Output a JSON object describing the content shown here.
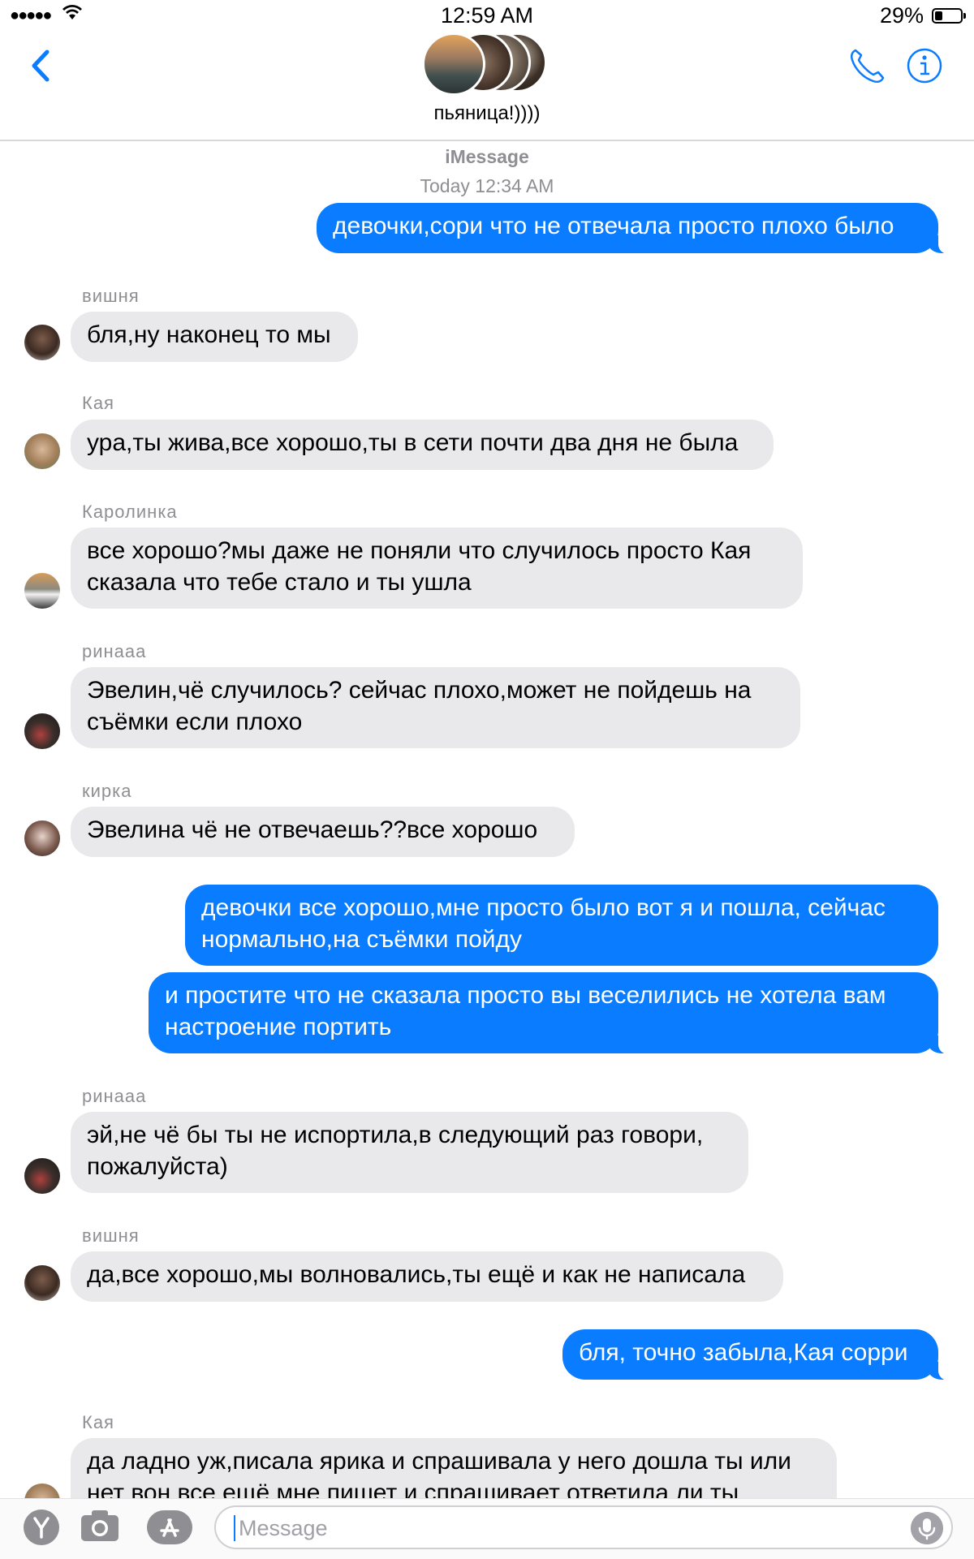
{
  "status_bar": {
    "time": "12:59 AM",
    "battery_percent": "29%",
    "battery_level": 0.29,
    "signal_glyphs": "●●●●●"
  },
  "header": {
    "group_name": "пьяница!))))",
    "back_icon": "chevron-left-icon",
    "call_icon": "phone-icon",
    "info_icon": "info-icon"
  },
  "thread": {
    "service_label": "iMessage",
    "timestamp": "Today 12:34 AM"
  },
  "messages": [
    {
      "direction": "sent",
      "text": "девочки,сори что не отвечала просто плохо было"
    },
    {
      "direction": "received",
      "sender": "вишня",
      "text": "бля,ну наконец то мы"
    },
    {
      "direction": "received",
      "sender": "Кая",
      "text": "ура,ты жива,все хорошо,ты в сети почти два дня не была"
    },
    {
      "direction": "received",
      "sender": "Каролинка",
      "text": "все хорошо?мы даже не поняли что случилось просто Кая сказала что тебе стало и ты ушла"
    },
    {
      "direction": "received",
      "sender": "ринааа",
      "text": "Эвелин,чё случилось? сейчас плохо,может не пойдешь на съёмки если плохо"
    },
    {
      "direction": "received",
      "sender": "кирка",
      "text": "Эвелина чё не отвечаешь??все хорошо"
    },
    {
      "direction": "sent",
      "text": "девочки все хорошо,мне просто было вот я и пошла, сейчас нормально,на съёмки пойду"
    },
    {
      "direction": "sent",
      "text": "и простите что не сказала просто вы веселились не хотела вам настроение портить"
    },
    {
      "direction": "received",
      "sender": "ринааа",
      "text": "эй,не чё бы ты не испортила,в следующий раз говори, пожалуйста)"
    },
    {
      "direction": "received",
      "sender": "вишня",
      "text": "да,все хорошо,мы волновались,ты ещё и как не написала"
    },
    {
      "direction": "sent",
      "text": "бля, точно забыла,Кая сорри"
    },
    {
      "direction": "received",
      "sender": "Кая",
      "text": "да ладно уж,писала ярика и спрашивала у него дошла ты или нет вон все ещё мне пишет и спрашивает ответила ли ты"
    }
  ],
  "composer": {
    "placeholder": "Message",
    "apps": [
      "yandex-icon",
      "camera-icon",
      "app-store-icon",
      "mic-icon"
    ]
  }
}
